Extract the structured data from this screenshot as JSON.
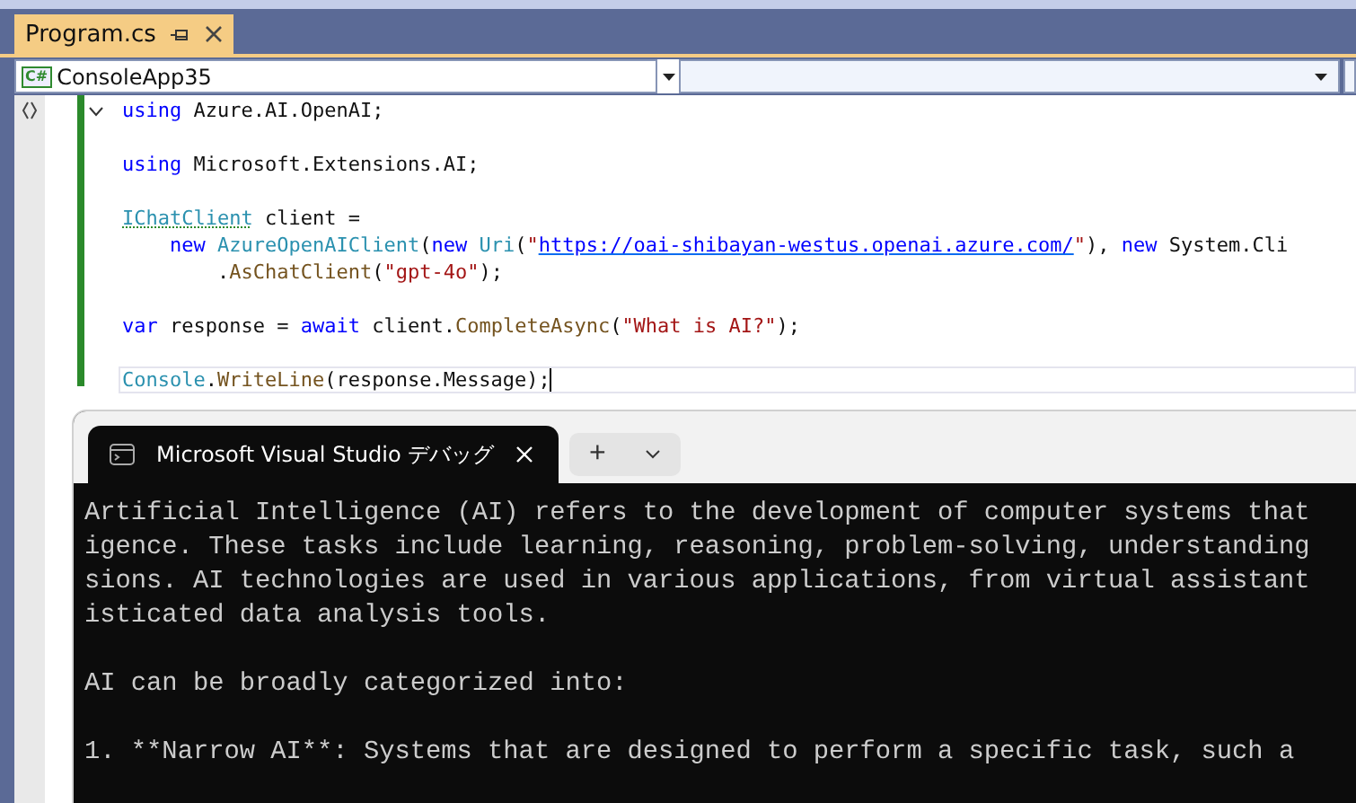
{
  "editor_tab": {
    "title": "Program.cs",
    "pinned": false
  },
  "project_dropdown": {
    "value": "ConsoleApp35",
    "badge": "C#"
  },
  "code_lines": [
    {
      "current": false,
      "tokens": [
        {
          "kind": "keyword",
          "text": "using"
        },
        {
          "kind": "plain",
          "text": " Azure.AI.OpenAI;"
        }
      ]
    },
    {
      "current": false
    },
    {
      "current": false,
      "tokens": [
        {
          "kind": "keyword",
          "text": "using"
        },
        {
          "kind": "plain",
          "text": " Microsoft.Extensions.AI;"
        }
      ]
    },
    {
      "current": false
    },
    {
      "current": false,
      "tokens": [
        {
          "kind": "type",
          "text": "IChatClient",
          "warning": true
        },
        {
          "kind": "plain",
          "text": " client ="
        }
      ]
    },
    {
      "current": false,
      "tokens": [
        {
          "kind": "keyword",
          "text": "    new"
        },
        {
          "kind": "type",
          "text": " AzureOpenAIClient"
        },
        {
          "kind": "plain",
          "text": "("
        },
        {
          "kind": "keyword",
          "text": "new"
        },
        {
          "kind": "type",
          "text": " Uri"
        },
        {
          "kind": "plain",
          "text": "("
        },
        {
          "kind": "string",
          "text": "\""
        },
        {
          "kind": "link",
          "text": "https://oai-shibayan-westus.openai.azure.com/"
        },
        {
          "kind": "string",
          "text": "\""
        },
        {
          "kind": "plain",
          "text": "), "
        },
        {
          "kind": "keyword",
          "text": "new"
        },
        {
          "kind": "plain",
          "text": " System.Cli"
        }
      ]
    },
    {
      "current": false,
      "tokens": [
        {
          "kind": "plain",
          "text": "        ."
        },
        {
          "kind": "method",
          "text": "AsChatClient"
        },
        {
          "kind": "plain",
          "text": "("
        },
        {
          "kind": "string",
          "text": "\"gpt-4o\""
        },
        {
          "kind": "plain",
          "text": ");"
        }
      ]
    },
    {
      "current": false
    },
    {
      "current": false,
      "tokens": [
        {
          "kind": "keyword",
          "text": "var"
        },
        {
          "kind": "plain",
          "text": " response = "
        },
        {
          "kind": "keyword",
          "text": "await"
        },
        {
          "kind": "plain",
          "text": " client."
        },
        {
          "kind": "method",
          "text": "CompleteAsync"
        },
        {
          "kind": "plain",
          "text": "("
        },
        {
          "kind": "string",
          "text": "\"What is AI?\""
        },
        {
          "kind": "plain",
          "text": ");"
        }
      ]
    },
    {
      "current": false
    },
    {
      "current": true,
      "tokens": [
        {
          "kind": "type",
          "text": "Console"
        },
        {
          "kind": "plain",
          "text": "."
        },
        {
          "kind": "method",
          "text": "WriteLine"
        },
        {
          "kind": "plain",
          "text": "(response.Message);"
        }
      ]
    }
  ],
  "terminal": {
    "tab_title": "Microsoft Visual Studio デバッグ",
    "new_tab_button": "+",
    "paragraphs": [
      [
        "Artificial Intelligence (AI) refers to the development of computer systems that",
        "igence. These tasks include learning, reasoning, problem-solving, understanding",
        "sions. AI technologies are used in various applications, from virtual assistant",
        "isticated data analysis tools."
      ],
      [
        "AI can be broadly categorized into:"
      ],
      [
        "1. **Narrow AI**: Systems that are designed to perform a specific task, such a"
      ]
    ]
  }
}
